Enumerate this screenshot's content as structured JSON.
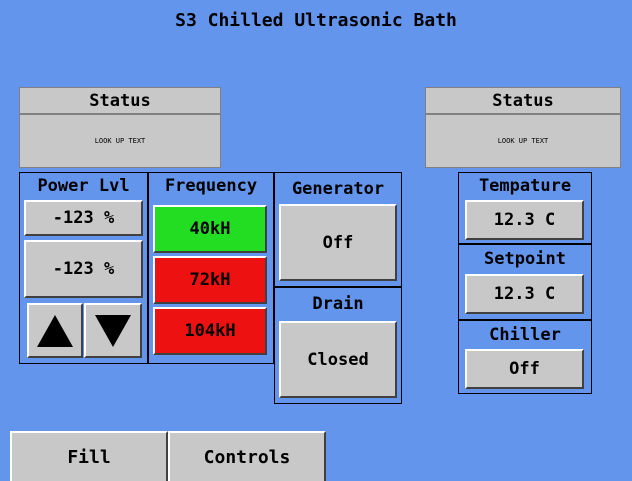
{
  "title": "S3 Chilled Ultrasonic Bath",
  "status_left": {
    "label": "Status",
    "text": "LOOK UP TEXT"
  },
  "status_right": {
    "label": "Status",
    "text": "LOOK UP TEXT"
  },
  "power": {
    "label": "Power Lvl",
    "value1": "-123 %",
    "value2": "-123 %",
    "up_icon": "up-arrow-icon",
    "down_icon": "down-arrow-icon"
  },
  "frequency": {
    "label": "Frequency",
    "options": [
      "40kH",
      "72kH",
      "104kH"
    ],
    "colors": [
      "#22dd22",
      "#ee1111",
      "#ee1111"
    ]
  },
  "generator": {
    "label": "Generator",
    "value": "Off"
  },
  "drain": {
    "label": "Drain",
    "value": "Closed"
  },
  "temperature": {
    "label": "Tempature",
    "value": "12.3 C"
  },
  "setpoint": {
    "label": "Setpoint",
    "value": "12.3 C"
  },
  "chiller": {
    "label": "Chiller",
    "value": "Off"
  },
  "tabs": {
    "fill": "Fill",
    "controls": "Controls"
  }
}
